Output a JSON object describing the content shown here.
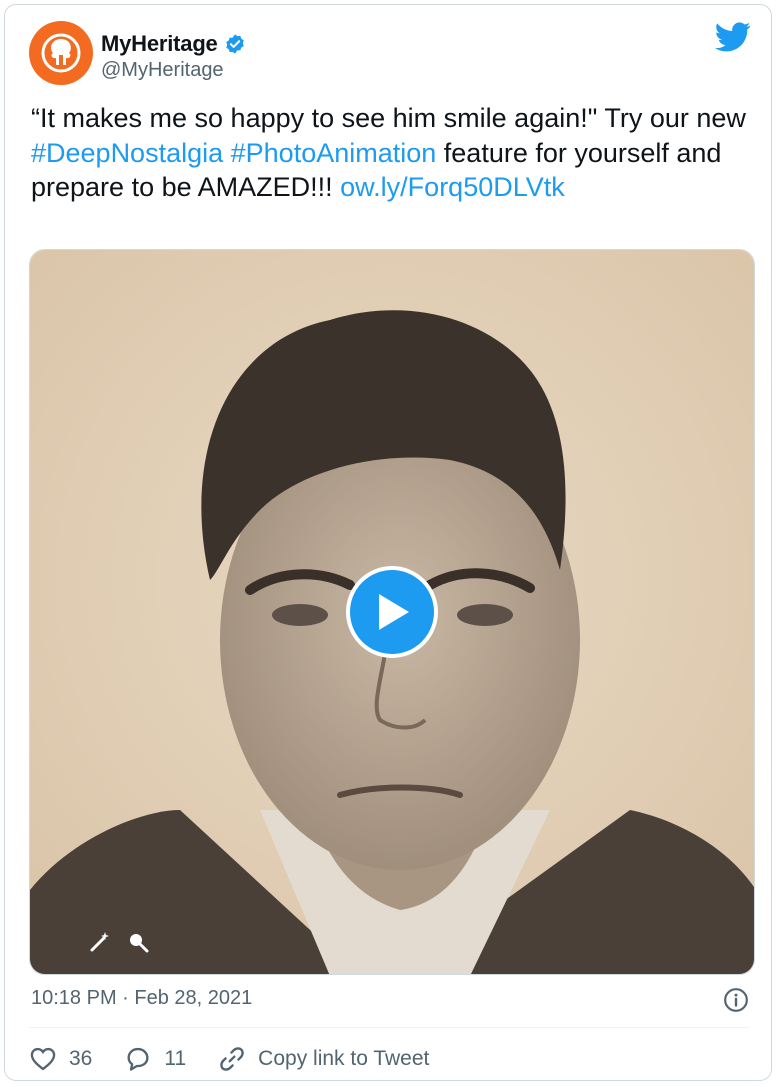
{
  "account": {
    "display_name": "MyHeritage",
    "handle": "@MyHeritage",
    "verified": true
  },
  "tweet": {
    "text_parts": [
      {
        "text": "“It makes me so happy to see him smile again!\" Try our new ",
        "type": "plain"
      },
      {
        "text": "#DeepNostalgia",
        "type": "link"
      },
      {
        "text": " ",
        "type": "plain"
      },
      {
        "text": "#PhotoAnimation",
        "type": "link"
      },
      {
        "text": " feature for yourself and prepare to be AMAZED!!! ",
        "type": "plain"
      },
      {
        "text": "ow.ly/Forq50DLVtk",
        "type": "link"
      }
    ]
  },
  "media": {
    "type": "video",
    "icons": [
      "magic-wand-icon",
      "magnifier-icon"
    ]
  },
  "meta": {
    "timestamp": "10:18 PM · Feb 28, 2021"
  },
  "actions": {
    "likes": "36",
    "replies": "11",
    "copy_link": "Copy link to Tweet"
  },
  "colors": {
    "accent": "#1d9bf0",
    "brand": "#f26b21",
    "muted": "#536471"
  }
}
